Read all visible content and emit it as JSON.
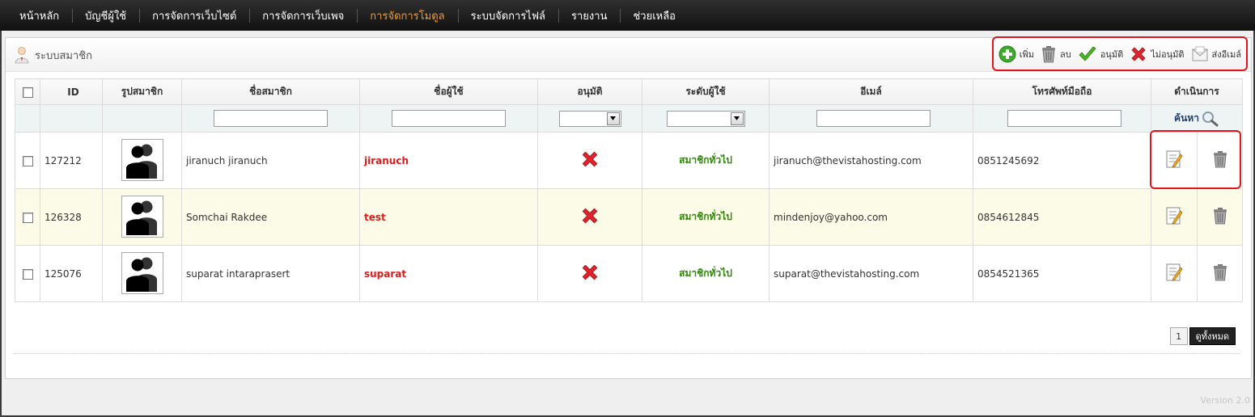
{
  "menu": [
    {
      "label": "หน้าหลัก",
      "active": false
    },
    {
      "label": "บัญชีผู้ใช้",
      "active": false
    },
    {
      "label": "การจัดการเว็บไซต์",
      "active": false
    },
    {
      "label": "การจัดการเว็บเพจ",
      "active": false
    },
    {
      "label": "การจัดการโมดูล",
      "active": true
    },
    {
      "label": "ระบบจัดการไฟล์",
      "active": false
    },
    {
      "label": "รายงาน",
      "active": false
    },
    {
      "label": "ช่วยเหลือ",
      "active": false
    }
  ],
  "page": {
    "title": "ระบบสมาชิก"
  },
  "toolbar": {
    "add": "เพิ่ม",
    "delete": "ลบ",
    "approve": "อนุมัติ",
    "disapprove": "ไม่อนุมัติ",
    "send_email": "ส่งอีเมล์"
  },
  "table": {
    "headers": {
      "id": "ID",
      "photo": "รูปสมาชิก",
      "name": "ชื่อสมาชิก",
      "username": "ชื่อผู้ใช้",
      "approved": "อนุมัติ",
      "level": "ระดับผู้ใช้",
      "email": "อีเมล์",
      "phone": "โทรศัพท์มือถือ",
      "actions": "ดำเนินการ"
    },
    "search_label": "ค้นหา",
    "rows": [
      {
        "id": "127212",
        "name": "jiranuch  jiranuch",
        "username": "jiranuch",
        "approved": false,
        "level": "สมาชิกทั่วไป",
        "email": "jiranuch@thevistahosting.com",
        "phone": "0851245692"
      },
      {
        "id": "126328",
        "name": "Somchai  Rakdee",
        "username": "test",
        "approved": false,
        "level": "สมาชิกทั่วไป",
        "email": "mindenjoy@yahoo.com",
        "phone": "0854612845"
      },
      {
        "id": "125076",
        "name": "suparat  intaraprasert",
        "username": "suparat",
        "approved": false,
        "level": "สมาชิกทั่วไป",
        "email": "suparat@thevistahosting.com",
        "phone": "0854521365"
      }
    ]
  },
  "pagination": {
    "current": "1",
    "view_all": "ดูทั้งหมด"
  },
  "footer": {
    "version": "Version 2.0"
  },
  "colors": {
    "accent_menu": "#ff9a1f",
    "highlight_box": "#e3141c",
    "username": "#e01b1b",
    "level": "#2a8a00"
  }
}
